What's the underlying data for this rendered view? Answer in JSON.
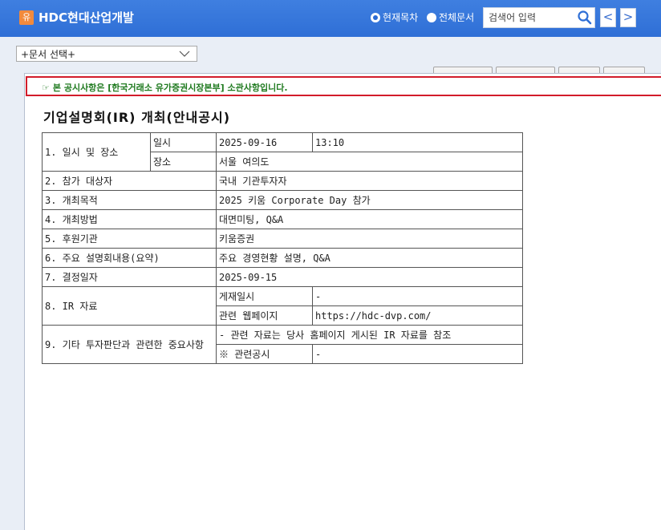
{
  "header": {
    "logo_char": "유",
    "title": "HDC현대산업개발",
    "radio_current": "현재목차",
    "radio_all": "전체문서",
    "search_placeholder": "검색어 입력",
    "prev_label": "<",
    "next_label": ">"
  },
  "doc_select": {
    "value": "+문서 선택+"
  },
  "notice": {
    "icon": "☞",
    "text": "본 공시사항은 [한국거래소 유가증권시장본부] 소관사항입니다."
  },
  "doc": {
    "title": "기업설명회(IR) 개최(안내공시)",
    "rows": {
      "r1_label": "1. 일시 및 장소",
      "r1a_key": "일시",
      "r1a_date": "2025-09-16",
      "r1a_time": "13:10",
      "r1b_key": "장소",
      "r1b_value": "서울 여의도",
      "r2_label": "2. 참가 대상자",
      "r2_value": "국내 기관투자자",
      "r3_label": "3. 개최목적",
      "r3_value": "2025 키움 Corporate Day 참가",
      "r4_label": "4. 개최방법",
      "r4_value": "대면미팅, Q&A",
      "r5_label": "5. 후원기관",
      "r5_value": "키움증권",
      "r6_label": "6. 주요 설명회내용(요약)",
      "r6_value": "주요 경영현황 설명, Q&A",
      "r7_label": "7. 결정일자",
      "r7_value": "2025-09-15",
      "r8_label": "8. IR 자료",
      "r8a_key": "게재일시",
      "r8a_value": "-",
      "r8b_key": "관련 웹페이지",
      "r8b_value": "https://hdc-dvp.com/",
      "r9_label": "9. 기타 투자판단과 관련한 중요사항",
      "r9a_value": "- 관련 자료는 당사 홈페이지 게시된 IR 자료를 참조",
      "r9b_key": "※ 관련공시",
      "r9b_value": "-"
    }
  },
  "colors": {
    "header_blue": "#2f6fd6",
    "notice_border": "#d21c2b",
    "notice_text": "#1f7a1f",
    "logo_orange": "#f28a3c"
  }
}
